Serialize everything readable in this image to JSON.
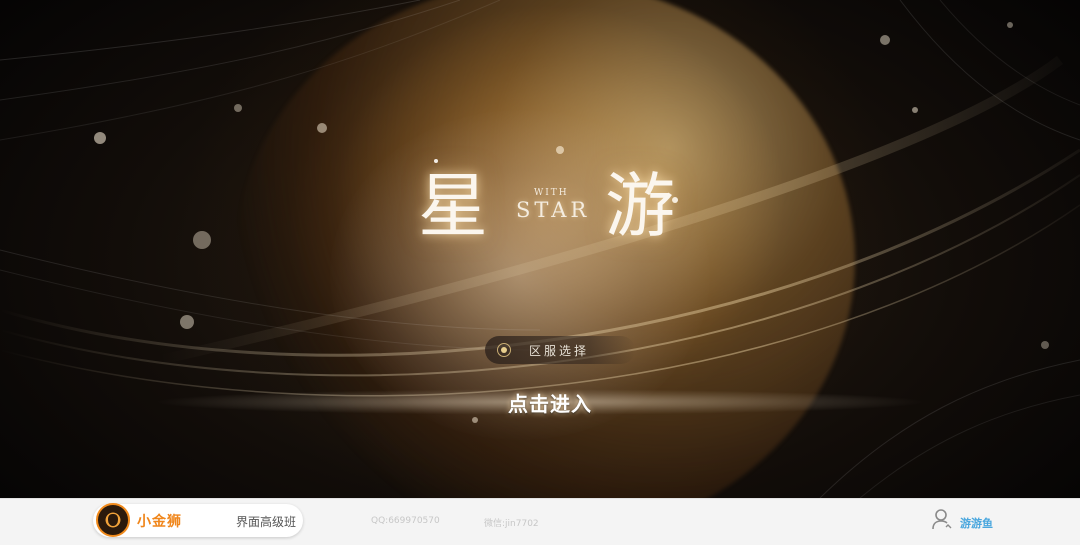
{
  "game": {
    "title_left": "星",
    "title_right": "游",
    "title_small": "WITH",
    "title_latin": "STAR",
    "server_select_label": "区服选择",
    "enter_label": "点击进入"
  },
  "footer": {
    "brand_name": "小金狮",
    "course_name": "界面高级班",
    "qq": "QQ:669970570",
    "wechat": "微信:jin7702",
    "user_name": "游游鱼"
  },
  "icons": {
    "logo": "lion-icon",
    "server": "radio-dot-icon",
    "user": "user-icon"
  },
  "colors": {
    "accent_orange": "#f0861b",
    "user_blue": "#4aa7de",
    "gold": "#e9cf8e"
  }
}
